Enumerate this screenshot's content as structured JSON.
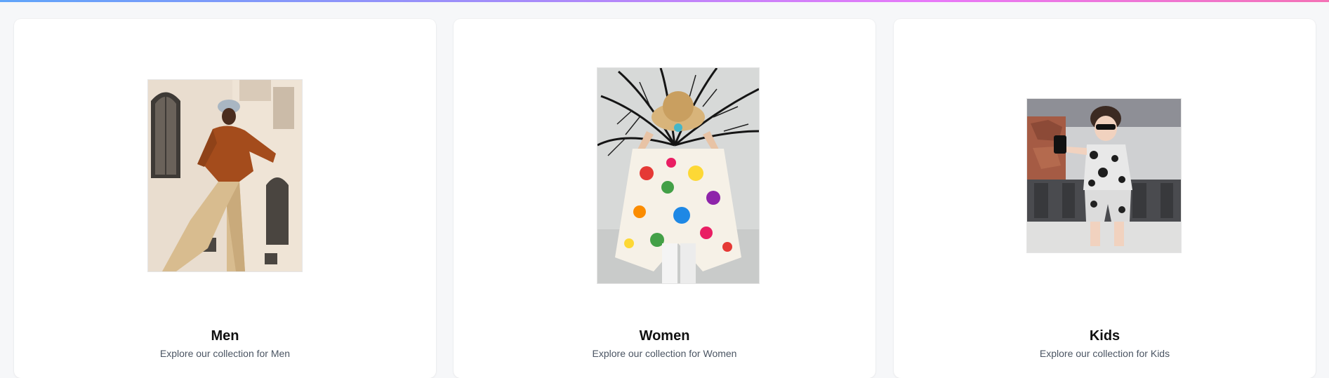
{
  "theme": {
    "accent_gradient": [
      "#60a5fa",
      "#a78bfa",
      "#e879f9",
      "#f472b6"
    ],
    "card_bg": "#ffffff",
    "page_bg": "#f6f7f9"
  },
  "categories": [
    {
      "title": "Men",
      "subtitle": "Explore our collection for Men",
      "image": "men-photo"
    },
    {
      "title": "Women",
      "subtitle": "Explore our collection for Women",
      "image": "women-photo"
    },
    {
      "title": "Kids",
      "subtitle": "Explore our collection for Kids",
      "image": "kids-photo"
    }
  ]
}
